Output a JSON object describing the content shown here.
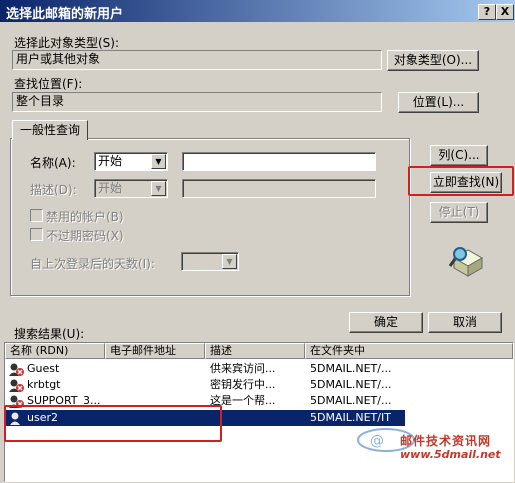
{
  "window": {
    "title": "选择此邮箱的新用户",
    "help_btn": "?",
    "close_btn": "X"
  },
  "object_type": {
    "label": "选择此对象类型(S):",
    "value": "用户或其他对象",
    "button": "对象类型(O)..."
  },
  "location": {
    "label": "查找位置(F):",
    "value": "整个目录",
    "button": "位置(L)..."
  },
  "tab": {
    "label": "一般性查询"
  },
  "query": {
    "name_label": "名称(A):",
    "name_mode": "开始",
    "desc_label": "描述(D):",
    "desc_mode": "开始",
    "disabled_accounts": "禁用的帐户(B)",
    "no_expire_pw": "不过期密码(X)",
    "days_label": "自上次登录后的天数(I):"
  },
  "side_buttons": {
    "columns": "列(C)...",
    "find_now": "立即查找(N)",
    "stop": "停止(T)"
  },
  "ok": "确定",
  "cancel": "取消",
  "results": {
    "label": "搜索结果(U):",
    "columns": [
      "名称 (RDN)",
      "电子邮件地址",
      "描述",
      "在文件夹中"
    ],
    "rows": [
      {
        "name": "Guest",
        "email": "",
        "desc": "供来宾访问...",
        "folder": "5DMAIL.NET/...",
        "icon": "user-disabled-icon"
      },
      {
        "name": "krbtgt",
        "email": "",
        "desc": "密钥发行中...",
        "folder": "5DMAIL.NET/...",
        "icon": "user-disabled-icon"
      },
      {
        "name": "SUPPORT_3...",
        "email": "",
        "desc": "这是一个帮...",
        "folder": "5DMAIL.NET/...",
        "icon": "user-disabled-icon"
      },
      {
        "name": "user2",
        "email": "",
        "desc": "",
        "folder": "5DMAIL.NET/IT",
        "icon": "user-icon"
      }
    ]
  },
  "watermark": {
    "text": "邮件技术资讯网",
    "url": "www.5dmail.net"
  },
  "colors": {
    "titlebar": "#0a246a",
    "selection": "#0a246a",
    "highlight_box": "#d21f1f",
    "dialog_bg": "#d4d0c8"
  }
}
